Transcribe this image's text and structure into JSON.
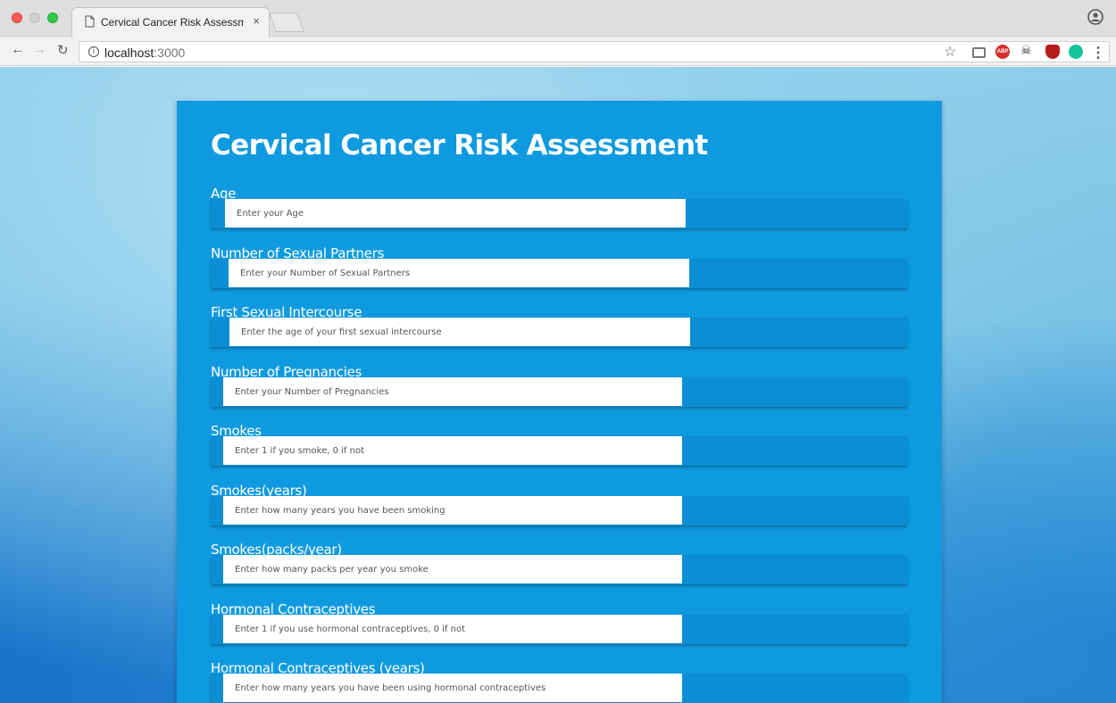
{
  "browser": {
    "tab_title": "Cervical Cancer Risk Assessme",
    "tab_close": "×",
    "url_host": "localhost",
    "url_port": ":3000",
    "info_glyph": "i",
    "abp_label": "ABP"
  },
  "form": {
    "title": "Cervical Cancer Risk Assessment",
    "fields": [
      {
        "label": "Age",
        "placeholder": "Enter your Age"
      },
      {
        "label": "Number of Sexual Partners",
        "placeholder": "Enter your Number of Sexual Partners"
      },
      {
        "label": "First Sexual Intercourse",
        "placeholder": "Enter the age of your first sexual intercourse"
      },
      {
        "label": "Number of Pregnancies",
        "placeholder": "Enter your Number of Pregnancies"
      },
      {
        "label": "Smokes",
        "placeholder": "Enter 1 if you smoke, 0 if not"
      },
      {
        "label": "Smokes(years)",
        "placeholder": "Enter how many years you have been smoking"
      },
      {
        "label": "Smokes(packs/year)",
        "placeholder": "Enter how many packs per year you smoke"
      },
      {
        "label": "Hormonal Contraceptives",
        "placeholder": "Enter 1 if you use hormonal contraceptives, 0 if not"
      },
      {
        "label": "Hormonal Contraceptives (years)",
        "placeholder": "Enter how many years you have been using hormonal contraceptives"
      }
    ]
  },
  "colors": {
    "card": "#0f9ae0",
    "field_strip": "#0b8ed3"
  }
}
